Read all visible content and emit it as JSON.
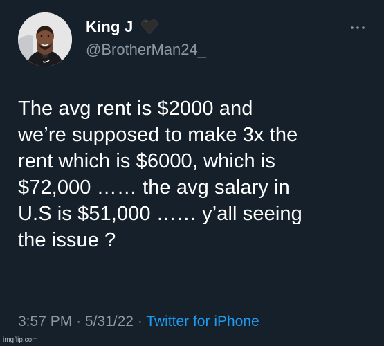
{
  "tweet": {
    "display_name": "King J",
    "handle": "@BrotherMan24_",
    "text": "The avg rent is $2000 and\nwe’re supposed to make 3x the\nrent which is $6000, which is\n$72,000 …… the avg salary in\nU.S is $51,000 …… y’all seeing\nthe issue ?",
    "time": "3:57 PM",
    "separator": "·",
    "date": "5/31/22",
    "source": "Twitter for iPhone"
  },
  "icons": {
    "name_emoji": "black-heart-icon",
    "menu": "more-dots-icon"
  },
  "watermark": "imgflip.com",
  "colors": {
    "background": "#15202b",
    "primary_text": "#ffffff",
    "secondary_text": "#8b98a5",
    "link": "#1d9bf0"
  }
}
